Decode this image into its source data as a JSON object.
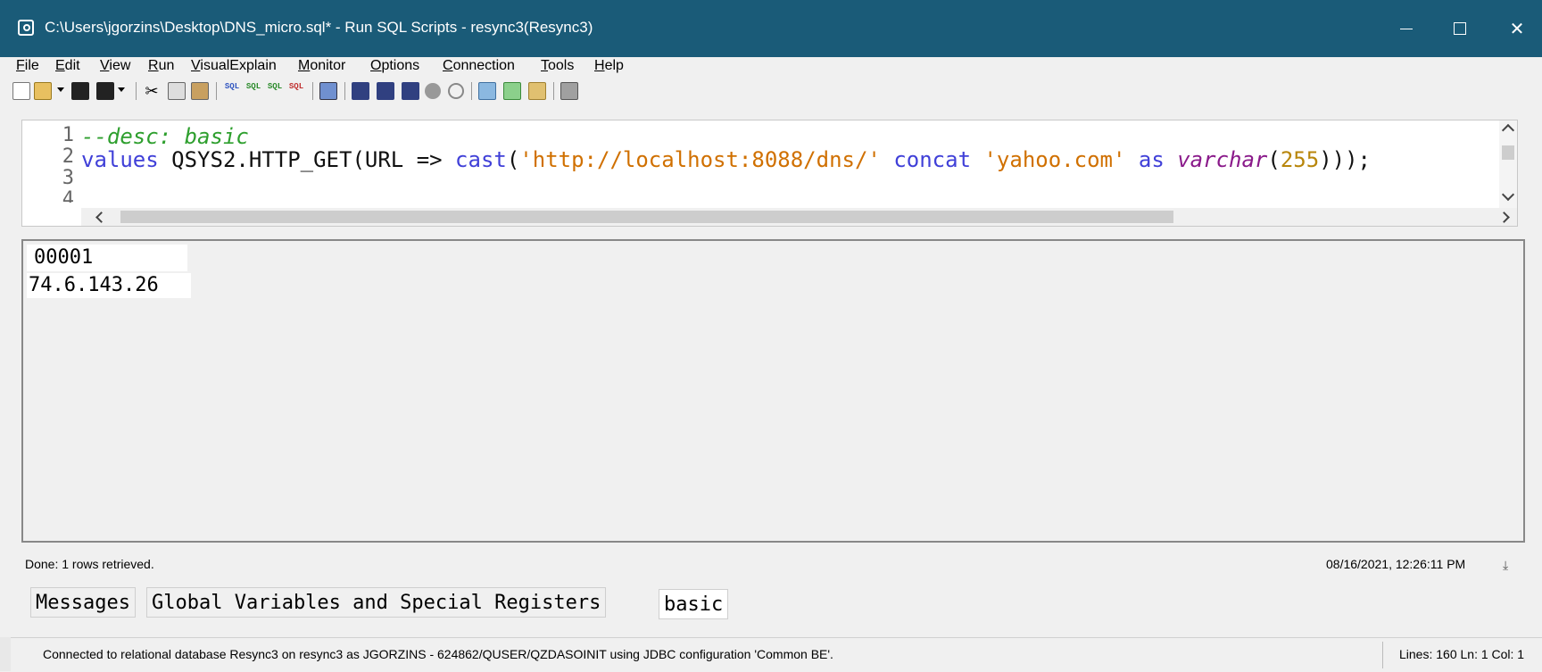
{
  "window": {
    "title": "C:\\Users\\jgorzins\\Desktop\\DNS_micro.sql* - Run SQL Scripts - resync3(Resync3)",
    "close_glyph": "✕"
  },
  "menu": {
    "file": "File",
    "edit": "Edit",
    "view": "View",
    "run": "Run",
    "visual_explain": "VisualExplain",
    "monitor": "Monitor",
    "options": "Options",
    "connection": "Connection",
    "tools": "Tools",
    "help": "Help"
  },
  "toolbar_sql_label": "SQL",
  "editor": {
    "line_numbers": [
      "1",
      "2",
      "3",
      "4"
    ],
    "line1": {
      "comment": "--desc: basic"
    },
    "line2": {
      "kw_values": "values",
      "id_func": " QSYS2.HTTP_GET(URL => ",
      "kw_cast": "cast",
      "paren_open": "(",
      "str_url": "'http://localhost:8088/dns/'",
      "kw_concat": " concat ",
      "str_domain": "'yahoo.com'",
      "kw_as": " as ",
      "type_varchar": "varchar",
      "paren2": "(",
      "num_len": "255",
      "closing": ")));"
    }
  },
  "results": {
    "column_header": "00001",
    "rows": [
      [
        "74.6.143.26"
      ]
    ]
  },
  "status": {
    "message": "Done: 1 rows retrieved.",
    "timestamp": "08/16/2021, 12:26:11 PM"
  },
  "tabs": [
    {
      "label": "Messages"
    },
    {
      "label": "Global Variables and Special Registers"
    },
    {
      "label": "basic"
    }
  ],
  "statusbar": {
    "connection": "Connected to relational database Resync3 on resync3 as JGORZINS - 624862/QUSER/QZDASOINIT using JDBC configuration 'Common BE'.",
    "position": "Lines: 160  Ln: 1  Col: 1"
  },
  "colors": {
    "titlebar": "#1a5b78",
    "comment": "#2e9f2e",
    "keyword": "#4040d8",
    "string": "#d07000"
  },
  "icons": [
    "app-icon",
    "new-file-icon",
    "open-folder-icon",
    "save-icon",
    "save-all-icon",
    "cut-icon",
    "copy-icon",
    "paste-icon",
    "sql-run-icon",
    "stop-icon",
    "print-icon",
    "download-icon"
  ]
}
